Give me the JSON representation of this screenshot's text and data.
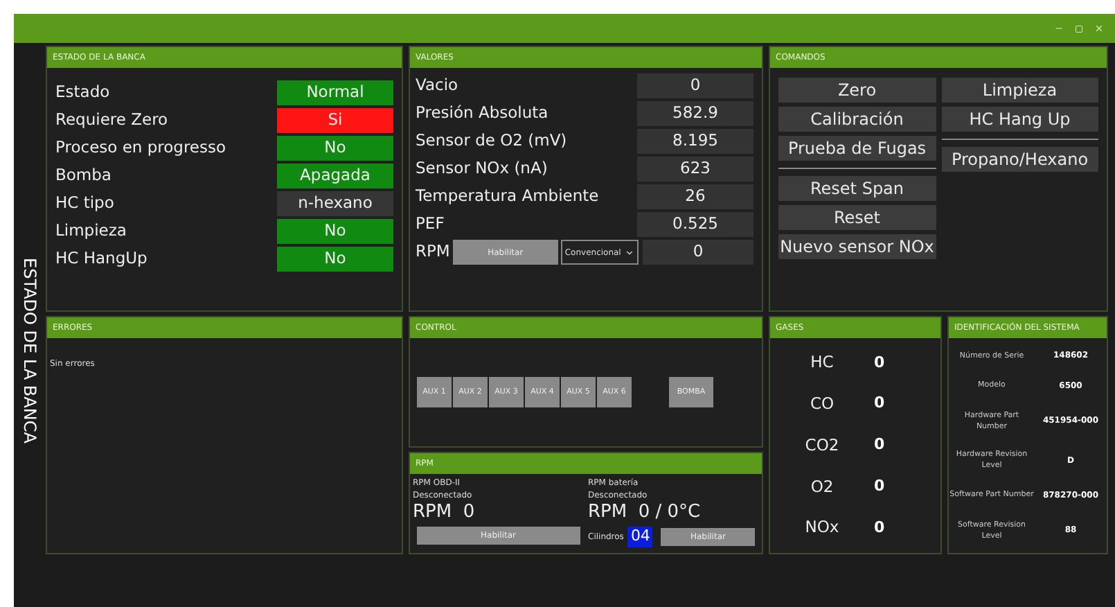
{
  "side_title": "ESTADO DE LA BANCA",
  "estado": {
    "title": "ESTADO DE LA BANCA",
    "rows": [
      {
        "label": "Estado",
        "value": "Normal",
        "color": "#108a10"
      },
      {
        "label": "Requiere Zero",
        "value": "Si",
        "color": "#ff1414"
      },
      {
        "label": "Proceso en progresso",
        "value": "No",
        "color": "#108a10"
      },
      {
        "label": "Bomba",
        "value": "Apagada",
        "color": "#108a10"
      },
      {
        "label": "HC tipo",
        "value": "n-hexano",
        "color": "#363636"
      },
      {
        "label": "Limpieza",
        "value": "No",
        "color": "#108a10"
      },
      {
        "label": "HC HangUp",
        "value": "No",
        "color": "#108a10"
      }
    ]
  },
  "valores": {
    "title": "VALORES",
    "rows": [
      {
        "label": "Vacio",
        "value": "0"
      },
      {
        "label": "Presión Absoluta",
        "value": "582.9"
      },
      {
        "label": "Sensor de O2 (mV)",
        "value": "8.195"
      },
      {
        "label": "Sensor NOx (nA)",
        "value": "623"
      },
      {
        "label": "Temperatura Ambiente",
        "value": "26"
      },
      {
        "label": "PEF",
        "value": "0.525"
      }
    ],
    "rpm": {
      "label": "RPM",
      "button": "Habilitar",
      "select": "Convencional",
      "value": "0"
    }
  },
  "comandos": {
    "title": "COMANDOS",
    "columns": [
      [
        {
          "kind": "button",
          "label": "Zero"
        },
        {
          "kind": "button",
          "label": "Calibración"
        },
        {
          "kind": "button",
          "label": "Prueba de Fugas"
        },
        {
          "kind": "separator"
        },
        {
          "kind": "button",
          "label": "Reset Span"
        },
        {
          "kind": "button",
          "label": "Reset"
        },
        {
          "kind": "button",
          "label": "Nuevo sensor NOx"
        }
      ],
      [
        {
          "kind": "button",
          "label": "Limpieza"
        },
        {
          "kind": "button",
          "label": "HC Hang Up"
        },
        {
          "kind": "separator"
        },
        {
          "kind": "button",
          "label": "Propano/Hexano"
        }
      ]
    ]
  },
  "errores": {
    "title": "ERRORES",
    "message": "Sin errores"
  },
  "control": {
    "title": "CONTROL",
    "aux": [
      "AUX 1",
      "AUX 2",
      "AUX 3",
      "AUX 4",
      "AUX 5",
      "AUX 6"
    ],
    "pump": "BOMBA"
  },
  "rpm": {
    "title": "RPM",
    "obd": {
      "label": "RPM OBD-II",
      "status": "Desconectado",
      "reading": "RPM  0",
      "button": "Habilitar"
    },
    "battery": {
      "label": "RPM batería",
      "status": "Desconectado",
      "reading": "RPM  0 / 0°C",
      "cyl_label": "Cilindros",
      "cyl_value": "04",
      "button": "Habilitar"
    }
  },
  "gases": {
    "title": "GASES",
    "rows": [
      {
        "name": "HC",
        "value": "0"
      },
      {
        "name": "CO",
        "value": "0"
      },
      {
        "name": "CO2",
        "value": "0"
      },
      {
        "name": "O2",
        "value": "0"
      },
      {
        "name": "NOx",
        "value": "0"
      }
    ]
  },
  "identificacion": {
    "title": "IDENTIFICACIÓN DEL SISTEMA",
    "rows": [
      {
        "label": "Número de Serie",
        "value": "148602"
      },
      {
        "label": "Modelo",
        "value": "6500"
      },
      {
        "label": "Hardware Part Number",
        "value": "451954-000"
      },
      {
        "label": "Hardware Revision Level",
        "value": "D"
      },
      {
        "label": "Software Part Number",
        "value": "878270-000"
      },
      {
        "label": "Software Revision Level",
        "value": "88"
      }
    ]
  }
}
